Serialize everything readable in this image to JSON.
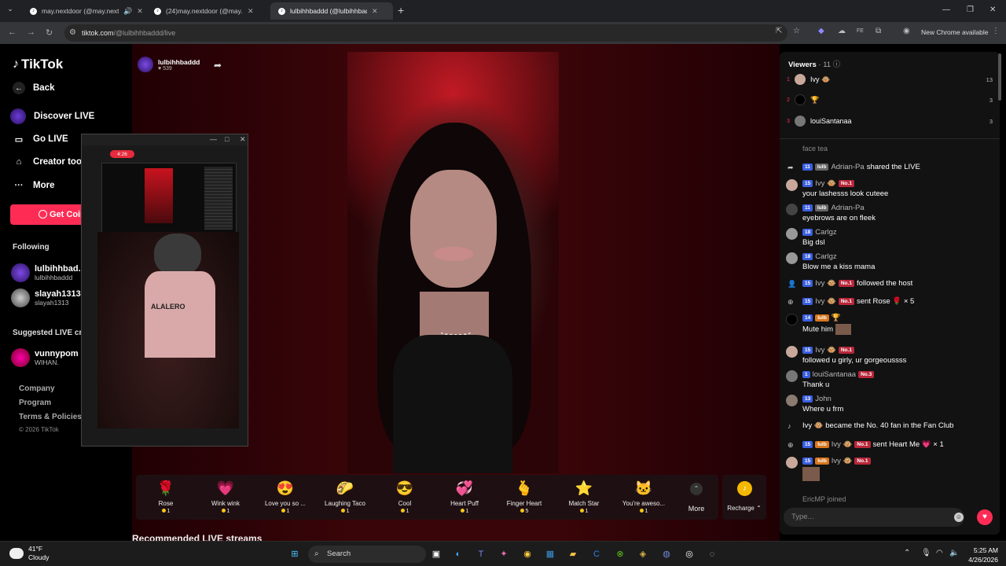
{
  "browser": {
    "tabs": [
      {
        "title": "may.nextdoor (@may.nextdo",
        "active": false
      },
      {
        "title": "(24)may.nextdoor (@may.nextdo",
        "active": false
      },
      {
        "title": "lulbihhbaddd (@lulbihhbad",
        "active": true
      }
    ],
    "url_host": "tiktok.com",
    "url_path": "/@lulbihhbaddd/live",
    "new_chrome_label": "New Chrome available"
  },
  "sidebar": {
    "logo": "TikTok",
    "back": "Back",
    "nav": [
      {
        "label": "Discover LIVE",
        "icon": "live-disc-icon"
      },
      {
        "label": "Go LIVE",
        "icon": "video-camera-icon"
      },
      {
        "label": "Creator tool",
        "icon": "creator-tools-icon"
      },
      {
        "label": "More",
        "icon": "more-dots-icon"
      }
    ],
    "get_coins": "Get Coin",
    "following_label": "Following",
    "following": [
      {
        "name": "lulbihhbad...",
        "handle": "lulbihhbaddd"
      },
      {
        "name": "slayah1313",
        "handle": "slayah1313"
      }
    ],
    "suggested_label": "Suggested LIVE crea",
    "suggested": [
      {
        "name": "vunnypom",
        "handle": "WIHAN."
      }
    ],
    "footer": [
      "Company",
      "Program",
      "Terms & Policies"
    ],
    "copyright": "© 2026 TikTok"
  },
  "stream": {
    "host_name": "lulbihhbaddd",
    "host_likes": "539",
    "pip_time": "4:26",
    "pip_shirt_text": "ALALERO"
  },
  "gifts": [
    {
      "name": "Rose",
      "cost": "1",
      "icon": "🌹"
    },
    {
      "name": "Wink wink",
      "cost": "1",
      "icon": "💗"
    },
    {
      "name": "Love you so ...",
      "cost": "1",
      "icon": "😍"
    },
    {
      "name": "Laughing Taco",
      "cost": "1",
      "icon": "🌮"
    },
    {
      "name": "Cool",
      "cost": "1",
      "icon": "😎"
    },
    {
      "name": "Heart Puff",
      "cost": "1",
      "icon": "💞"
    },
    {
      "name": "Finger Heart",
      "cost": "5",
      "icon": "🫰"
    },
    {
      "name": "Match Star",
      "cost": "1",
      "icon": "⭐"
    },
    {
      "name": "You're aweso...",
      "cost": "1",
      "icon": "🐱"
    }
  ],
  "gift_more": "More",
  "recharge": "Recharge",
  "recommended_title": "Recommended LIVE streams",
  "chat": {
    "viewers_label": "Viewers",
    "viewers_count": "· 11",
    "top_viewers": [
      {
        "rank": "1",
        "name": "Ivy 🐵",
        "score": "13"
      },
      {
        "rank": "2",
        "name": "🏆",
        "score": "3"
      },
      {
        "rank": "3",
        "name": "louiSantanaa",
        "score": "3"
      }
    ],
    "partial_top": "face tea",
    "messages": [
      {
        "level": "11",
        "badge": "lulb",
        "user": "Adrian-Pa",
        "text": "shared the LIVE",
        "system": true
      },
      {
        "level": "15",
        "rank": "No.1",
        "user": "Ivy 🐵",
        "text": "your lashesss look cuteee"
      },
      {
        "level": "11",
        "badge": "lulb",
        "user": "Adrian-Pa",
        "text": "eyebrows are on fleek"
      },
      {
        "level": "18",
        "user": "Carlgz",
        "text": "Big dsl"
      },
      {
        "level": "18",
        "user": "Carlgz",
        "text": "Blow me a kiss mama"
      },
      {
        "level": "15",
        "rank": "No.1",
        "user": "Ivy 🐵",
        "text": "followed the host",
        "system": true
      },
      {
        "level": "15",
        "rank": "No.1",
        "user": "Ivy 🐵",
        "text": "sent Rose 🌹 × 5",
        "system": true
      },
      {
        "level": "14",
        "badge": "lulb",
        "user": "",
        "text": "Mute him"
      },
      {
        "level": "15",
        "rank": "No.1",
        "user": "Ivy 🐵",
        "text": "followed u girly, ur gorgeoussss"
      },
      {
        "level": "1",
        "rank": "No.3",
        "user": "louiSantanaa",
        "text": "Thank u"
      },
      {
        "level": "13",
        "user": "John",
        "text": "Where u frm"
      },
      {
        "text": "Ivy 🐵 became the No. 40 fan in the Fan Club",
        "system": true
      },
      {
        "level": "15",
        "badge": "lulb",
        "rank": "No.1",
        "user": "Ivy 🐵",
        "text": "sent Heart Me 💗 × 1",
        "system": true
      },
      {
        "level": "15",
        "badge": "lulb",
        "rank": "No.1",
        "user": "Ivy 🐵",
        "text": ""
      }
    ],
    "partial_bottom": "EricMP  joined",
    "input_placeholder": "Type..."
  },
  "taskbar": {
    "temp": "41°F",
    "condition": "Cloudy",
    "search": "Search",
    "time": "5:25 AM",
    "date": "4/26/2026"
  }
}
